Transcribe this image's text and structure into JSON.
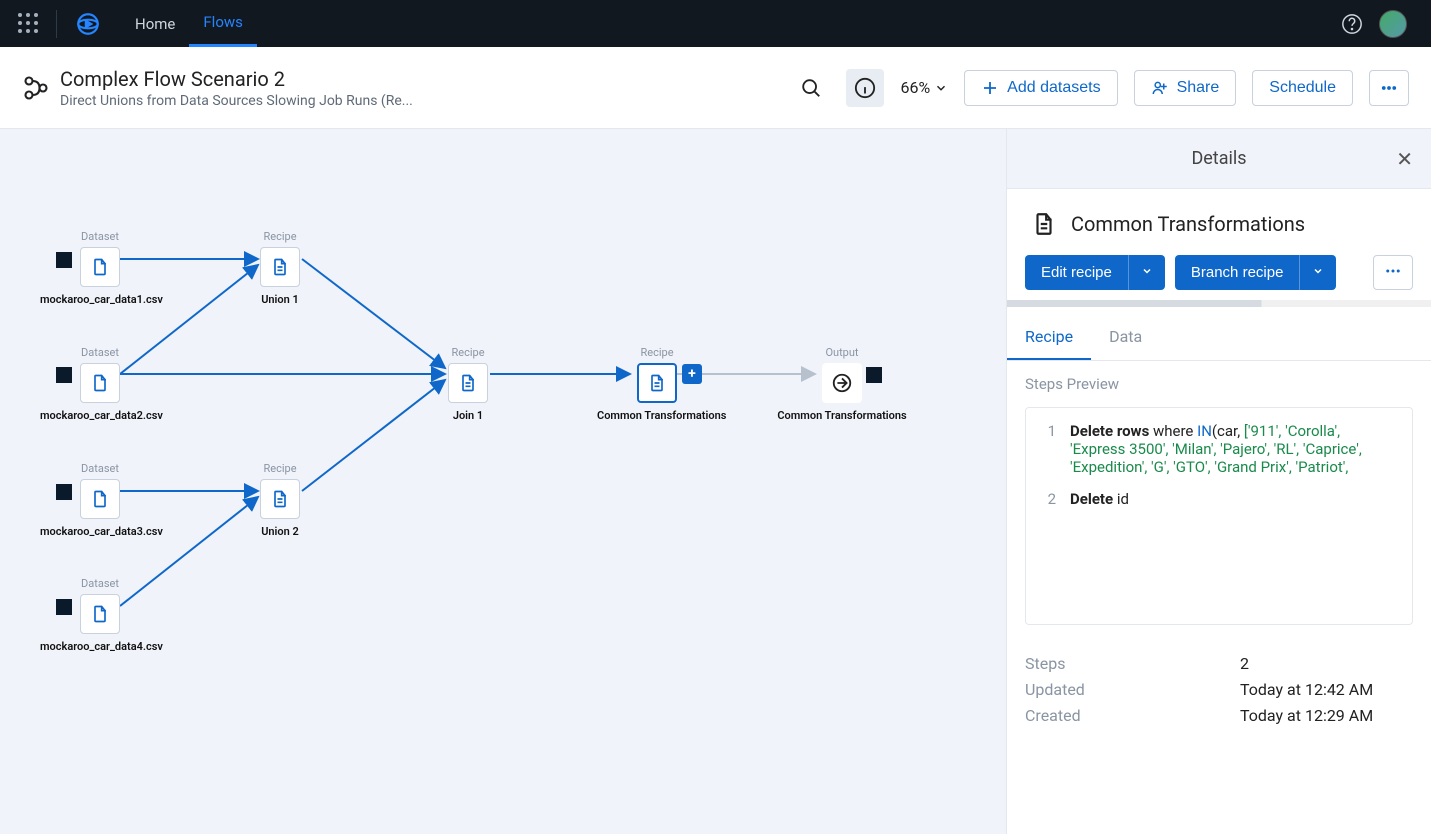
{
  "nav": {
    "home": "Home",
    "flows": "Flows"
  },
  "header": {
    "title": "Complex Flow Scenario 2",
    "subtitle": "Direct Unions from Data Sources Slowing Job Runs (Re...",
    "zoom": "66%",
    "add_datasets": "Add datasets",
    "share": "Share",
    "schedule": "Schedule"
  },
  "canvas": {
    "nodes": {
      "ds1": {
        "tag": "Dataset",
        "label": "mockaroo_car_data1.csv"
      },
      "ds2": {
        "tag": "Dataset",
        "label": "mockaroo_car_data2.csv"
      },
      "ds3": {
        "tag": "Dataset",
        "label": "mockaroo_car_data3.csv"
      },
      "ds4": {
        "tag": "Dataset",
        "label": "mockaroo_car_data4.csv"
      },
      "r1": {
        "tag": "Recipe",
        "label": "Union 1"
      },
      "r2": {
        "tag": "Recipe",
        "label": "Join 1"
      },
      "r3": {
        "tag": "Recipe",
        "label": "Common Transformations"
      },
      "r4": {
        "tag": "Recipe",
        "label": "Union 2"
      },
      "out": {
        "tag": "Output",
        "label": "Common Transformations"
      }
    }
  },
  "details": {
    "title": "Details",
    "recipe_name": "Common Transformations",
    "actions": {
      "edit": "Edit recipe",
      "branch": "Branch recipe"
    },
    "tabs": {
      "recipe": "Recipe",
      "data": "Data"
    },
    "steps_preview": "Steps Preview",
    "steps": [
      {
        "num": "1",
        "kw": "Delete rows",
        "post": " where ",
        "func": "IN",
        "lit": "['911', 'Corolla', 'Express 3500', 'Milan', 'Pajero', 'RL', 'Caprice', 'Expedition', 'G', 'GTO', 'Grand Prix', 'Patriot',",
        "pre_lit": "(car, "
      },
      {
        "num": "2",
        "kw": "Delete",
        "post": " id"
      }
    ],
    "meta": {
      "steps_label": "Steps",
      "steps_value": "2",
      "updated_label": "Updated",
      "updated_value": "Today at 12:42 AM",
      "created_label": "Created",
      "created_value": "Today at 12:29 AM"
    }
  }
}
